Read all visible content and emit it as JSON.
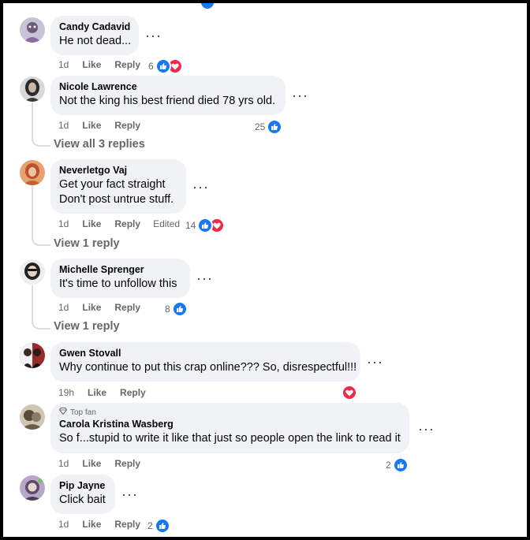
{
  "comments": [
    {
      "author": "Candy Cadavid",
      "text_lines": [
        "He not dead..."
      ],
      "time": "1d",
      "like_label": "Like",
      "reply_label": "Reply",
      "reaction_count": "6",
      "reactions": [
        "like-icon",
        "love-icon"
      ]
    },
    {
      "author": "Nicole Lawrence",
      "text_lines": [
        "Not the king his best friend died 78 yrs old."
      ],
      "time": "1d",
      "like_label": "Like",
      "reply_label": "Reply",
      "reaction_count": "25",
      "reactions": [
        "like-icon"
      ],
      "view_replies": "View all 3 replies"
    },
    {
      "author": "Neverletgo Vaj",
      "text_lines": [
        "Get your fact straight",
        "Don't post untrue stuff."
      ],
      "time": "1d",
      "like_label": "Like",
      "reply_label": "Reply",
      "edited_label": "Edited",
      "reaction_count": "14",
      "reactions": [
        "like-icon",
        "love-icon"
      ],
      "view_replies": "View 1 reply"
    },
    {
      "author": "Michelle Sprenger",
      "text_lines": [
        "It's time to unfollow this"
      ],
      "time": "1d",
      "like_label": "Like",
      "reply_label": "Reply",
      "reaction_count": "8",
      "reactions": [
        "like-icon"
      ],
      "view_replies": "View 1 reply"
    },
    {
      "author": "Gwen Stovall",
      "text_lines": [
        "Why continue to put this crap online??? So, disrespectful!!!"
      ],
      "time": "19h",
      "like_label": "Like",
      "reply_label": "Reply",
      "reaction_count": "",
      "reactions": [
        "love-icon"
      ]
    },
    {
      "badge": "Top fan",
      "author": "Carola Kristina Wasberg",
      "text_lines": [
        "So f...stupid to write it like that just so people open the link to read it"
      ],
      "time": "1d",
      "like_label": "Like",
      "reply_label": "Reply",
      "reaction_count": "2",
      "reactions": [
        "like-icon"
      ]
    },
    {
      "author": "Pip Jayne",
      "text_lines": [
        "Click bait"
      ],
      "time": "1d",
      "like_label": "Like",
      "reply_label": "Reply",
      "reaction_count": "2",
      "reactions": [
        "like-icon"
      ]
    }
  ],
  "colors": {
    "like": "#1877f2",
    "love": "#f02849",
    "bubble": "#f0f2f5",
    "meta": "#65676b"
  }
}
